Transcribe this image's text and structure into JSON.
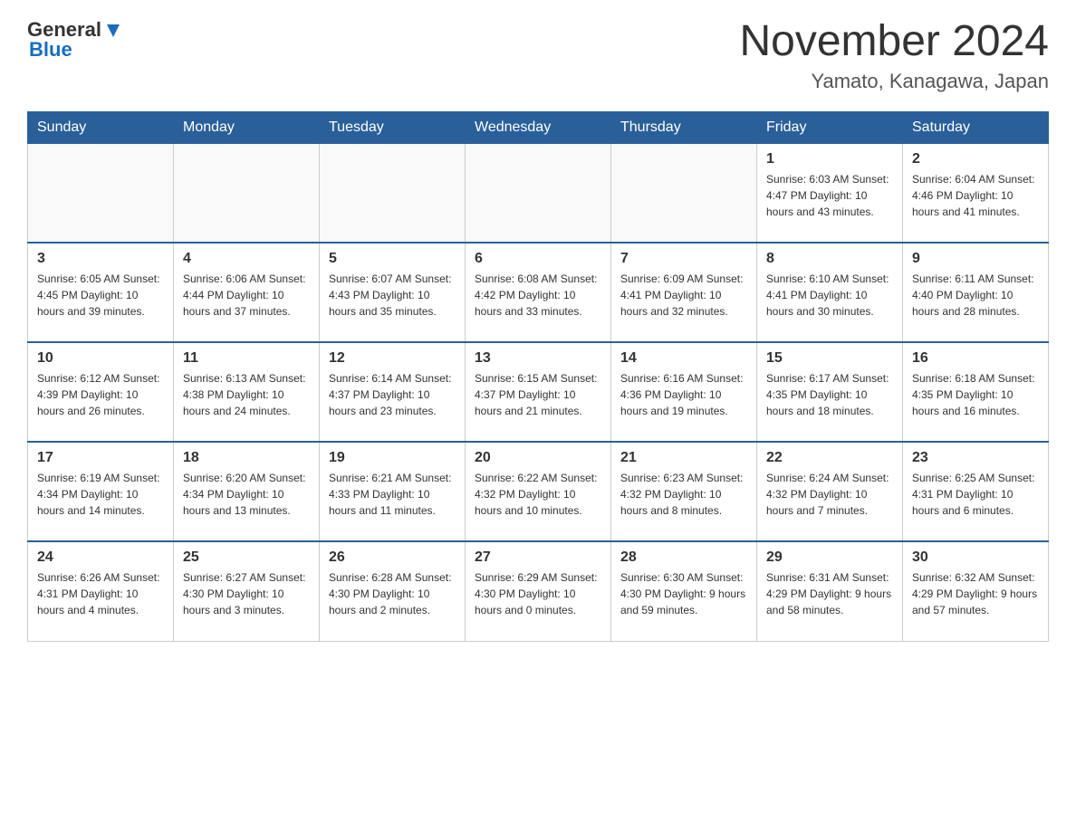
{
  "header": {
    "logo": {
      "general": "General",
      "blue": "Blue"
    },
    "title": "November 2024",
    "subtitle": "Yamato, Kanagawa, Japan"
  },
  "days_of_week": [
    "Sunday",
    "Monday",
    "Tuesday",
    "Wednesday",
    "Thursday",
    "Friday",
    "Saturday"
  ],
  "weeks": [
    [
      {
        "day": "",
        "info": ""
      },
      {
        "day": "",
        "info": ""
      },
      {
        "day": "",
        "info": ""
      },
      {
        "day": "",
        "info": ""
      },
      {
        "day": "",
        "info": ""
      },
      {
        "day": "1",
        "info": "Sunrise: 6:03 AM\nSunset: 4:47 PM\nDaylight: 10 hours\nand 43 minutes."
      },
      {
        "day": "2",
        "info": "Sunrise: 6:04 AM\nSunset: 4:46 PM\nDaylight: 10 hours\nand 41 minutes."
      }
    ],
    [
      {
        "day": "3",
        "info": "Sunrise: 6:05 AM\nSunset: 4:45 PM\nDaylight: 10 hours\nand 39 minutes."
      },
      {
        "day": "4",
        "info": "Sunrise: 6:06 AM\nSunset: 4:44 PM\nDaylight: 10 hours\nand 37 minutes."
      },
      {
        "day": "5",
        "info": "Sunrise: 6:07 AM\nSunset: 4:43 PM\nDaylight: 10 hours\nand 35 minutes."
      },
      {
        "day": "6",
        "info": "Sunrise: 6:08 AM\nSunset: 4:42 PM\nDaylight: 10 hours\nand 33 minutes."
      },
      {
        "day": "7",
        "info": "Sunrise: 6:09 AM\nSunset: 4:41 PM\nDaylight: 10 hours\nand 32 minutes."
      },
      {
        "day": "8",
        "info": "Sunrise: 6:10 AM\nSunset: 4:41 PM\nDaylight: 10 hours\nand 30 minutes."
      },
      {
        "day": "9",
        "info": "Sunrise: 6:11 AM\nSunset: 4:40 PM\nDaylight: 10 hours\nand 28 minutes."
      }
    ],
    [
      {
        "day": "10",
        "info": "Sunrise: 6:12 AM\nSunset: 4:39 PM\nDaylight: 10 hours\nand 26 minutes."
      },
      {
        "day": "11",
        "info": "Sunrise: 6:13 AM\nSunset: 4:38 PM\nDaylight: 10 hours\nand 24 minutes."
      },
      {
        "day": "12",
        "info": "Sunrise: 6:14 AM\nSunset: 4:37 PM\nDaylight: 10 hours\nand 23 minutes."
      },
      {
        "day": "13",
        "info": "Sunrise: 6:15 AM\nSunset: 4:37 PM\nDaylight: 10 hours\nand 21 minutes."
      },
      {
        "day": "14",
        "info": "Sunrise: 6:16 AM\nSunset: 4:36 PM\nDaylight: 10 hours\nand 19 minutes."
      },
      {
        "day": "15",
        "info": "Sunrise: 6:17 AM\nSunset: 4:35 PM\nDaylight: 10 hours\nand 18 minutes."
      },
      {
        "day": "16",
        "info": "Sunrise: 6:18 AM\nSunset: 4:35 PM\nDaylight: 10 hours\nand 16 minutes."
      }
    ],
    [
      {
        "day": "17",
        "info": "Sunrise: 6:19 AM\nSunset: 4:34 PM\nDaylight: 10 hours\nand 14 minutes."
      },
      {
        "day": "18",
        "info": "Sunrise: 6:20 AM\nSunset: 4:34 PM\nDaylight: 10 hours\nand 13 minutes."
      },
      {
        "day": "19",
        "info": "Sunrise: 6:21 AM\nSunset: 4:33 PM\nDaylight: 10 hours\nand 11 minutes."
      },
      {
        "day": "20",
        "info": "Sunrise: 6:22 AM\nSunset: 4:32 PM\nDaylight: 10 hours\nand 10 minutes."
      },
      {
        "day": "21",
        "info": "Sunrise: 6:23 AM\nSunset: 4:32 PM\nDaylight: 10 hours\nand 8 minutes."
      },
      {
        "day": "22",
        "info": "Sunrise: 6:24 AM\nSunset: 4:32 PM\nDaylight: 10 hours\nand 7 minutes."
      },
      {
        "day": "23",
        "info": "Sunrise: 6:25 AM\nSunset: 4:31 PM\nDaylight: 10 hours\nand 6 minutes."
      }
    ],
    [
      {
        "day": "24",
        "info": "Sunrise: 6:26 AM\nSunset: 4:31 PM\nDaylight: 10 hours\nand 4 minutes."
      },
      {
        "day": "25",
        "info": "Sunrise: 6:27 AM\nSunset: 4:30 PM\nDaylight: 10 hours\nand 3 minutes."
      },
      {
        "day": "26",
        "info": "Sunrise: 6:28 AM\nSunset: 4:30 PM\nDaylight: 10 hours\nand 2 minutes."
      },
      {
        "day": "27",
        "info": "Sunrise: 6:29 AM\nSunset: 4:30 PM\nDaylight: 10 hours\nand 0 minutes."
      },
      {
        "day": "28",
        "info": "Sunrise: 6:30 AM\nSunset: 4:30 PM\nDaylight: 9 hours\nand 59 minutes."
      },
      {
        "day": "29",
        "info": "Sunrise: 6:31 AM\nSunset: 4:29 PM\nDaylight: 9 hours\nand 58 minutes."
      },
      {
        "day": "30",
        "info": "Sunrise: 6:32 AM\nSunset: 4:29 PM\nDaylight: 9 hours\nand 57 minutes."
      }
    ]
  ]
}
